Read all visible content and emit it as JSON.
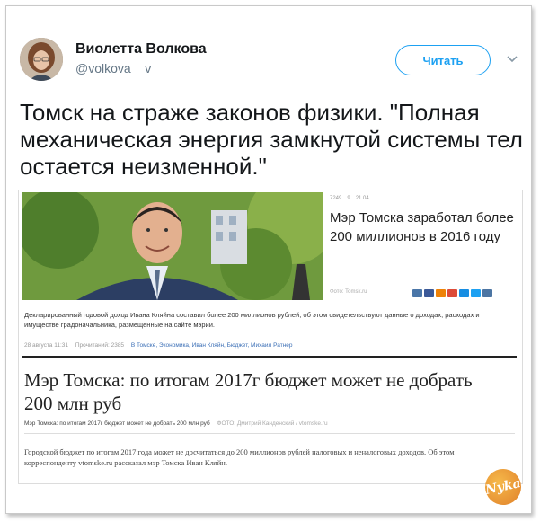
{
  "tweet": {
    "author_name": "Виолетта Волкова",
    "author_handle": "@volkova__v",
    "follow_label": "Читать",
    "text": "Томск на страже законов физики. \"Полная механическая энергия замкнутой системы тел остается неизменной.\""
  },
  "embedded": {
    "stats": [
      "7249",
      "9",
      "21.04"
    ],
    "side_headline": "Мэр Томска заработал более 200 миллионов в 2016 году",
    "photo_credit": "Фото: Tomsk.ru",
    "lead": "Декларированный годовой доход Ивана Кляйна составил более 200 миллионов рублей, об этом свидетельствуют данные о доходах, расходах и имуществе градоначальника, размещенные на сайте мэрии.",
    "meta_date": "28 августа 11:31",
    "meta_views": "Прочитаний: 2385",
    "meta_tags": "В Томске, Экономика, Иван Кляйн, Бюджет, Михаил Ратнер",
    "headline2": "Мэр Томска: по итогам 2017г бюджет может не добрать 200 млн руб",
    "caption2": "Мэр Томска: по итогам 2017г бюджет может не добрать 200 млн руб",
    "caption2_credit": "ФОТО: Дмитрий Канденский / vtomske.ru",
    "body2": "Городской бюджет по итогам 2017 года может не досчитаться до 200 миллионов рублей налоговых и неналоговых доходов. Об этом корреспонденту vtomske.ru рассказал мэр Томска Иван Кляйн."
  },
  "watermark": "Nyka",
  "colors": {
    "accent": "#1da1f2",
    "tags": "#3b6fb6"
  },
  "icons": [
    "chevron-down-icon",
    "eye-icon",
    "comment-icon"
  ]
}
